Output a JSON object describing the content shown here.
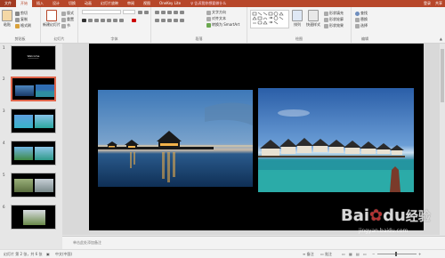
{
  "tabs": [
    {
      "label": "文件",
      "type": "file"
    },
    {
      "label": "开始",
      "type": "active"
    },
    {
      "label": "插入",
      "type": ""
    },
    {
      "label": "设计",
      "type": ""
    },
    {
      "label": "切换",
      "type": ""
    },
    {
      "label": "动画",
      "type": ""
    },
    {
      "label": "幻灯片放映",
      "type": ""
    },
    {
      "label": "审阅",
      "type": ""
    },
    {
      "label": "视图",
      "type": ""
    },
    {
      "label": "OneKey Lite",
      "type": ""
    }
  ],
  "tellme": "♀ 告诉我你想要做什么",
  "login": "登录",
  "share": "共享",
  "ribbon": {
    "paste": "粘贴",
    "cut": "剪切",
    "copy": "复制",
    "format_painter": "格式刷",
    "clipboard_label": "剪贴板",
    "new_slide": "新建幻灯片",
    "layout": "版式",
    "reset": "重置",
    "section": "节",
    "slides_label": "幻灯片",
    "font_label": "字体",
    "paragraph_label": "段落",
    "text_direction": "文字方向",
    "align_text": "对齐文本",
    "convert_smartart": "转换为 SmartArt",
    "drawing_label": "绘图",
    "arrange": "排列",
    "quick_styles": "快速样式",
    "shape_fill": "形状填充",
    "shape_outline": "形状轮廓",
    "shape_effects": "形状效果",
    "find": "查找",
    "replace": "替换",
    "select": "选择",
    "editing_label": "编辑"
  },
  "slides": [
    {
      "num": "1",
      "title": "Welcome"
    },
    {
      "num": "2"
    },
    {
      "num": "3"
    },
    {
      "num": "4"
    },
    {
      "num": "5"
    },
    {
      "num": "6"
    }
  ],
  "notes_placeholder": "单击此处添加备注",
  "status": {
    "slide_info": "幻灯片 第 2 张，共 6 张",
    "language": "中文(中国)",
    "notes": "备注",
    "comments": "批注"
  },
  "watermark": {
    "brand": "Bai",
    "brand2": "du",
    "jingyan": "经验",
    "url": "jingyan.baidu.com"
  },
  "colors": {
    "accent": "#b7472a",
    "selected_thumb": "#e0654b"
  }
}
